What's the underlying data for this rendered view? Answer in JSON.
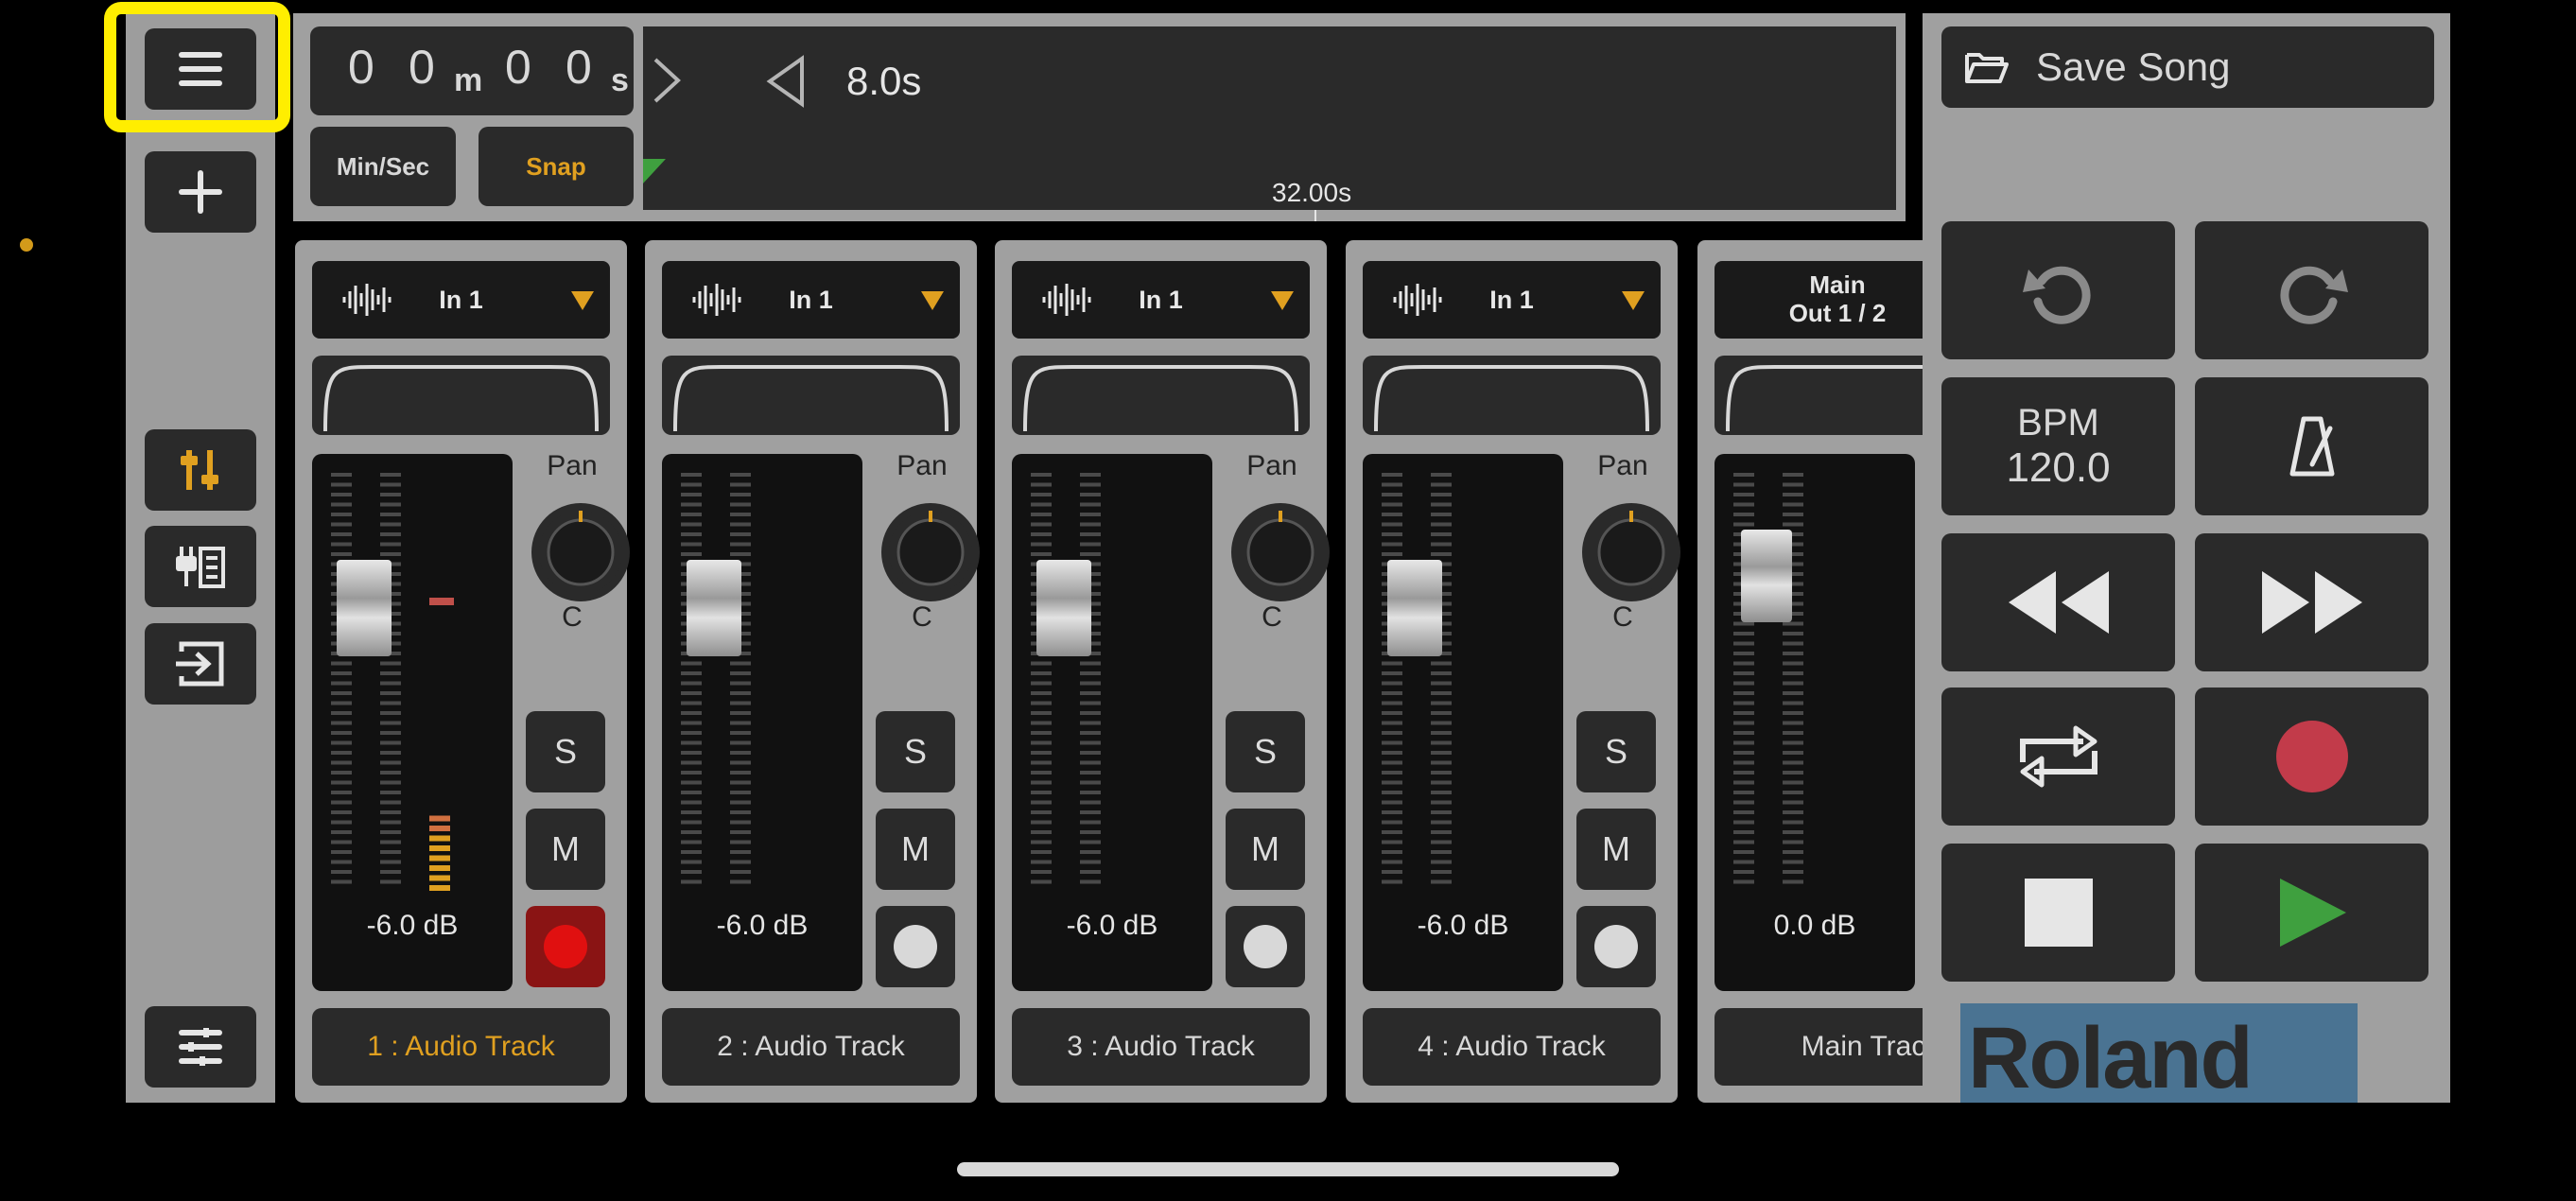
{
  "sidebar": {
    "buttons": [
      {
        "name": "menu-button",
        "icon": "hamburger-icon"
      },
      {
        "name": "add-track-button",
        "icon": "plus-icon"
      },
      {
        "name": "mixer-button",
        "icon": "mixer-sliders-icon"
      },
      {
        "name": "effects-button",
        "icon": "effects-plug-icon"
      },
      {
        "name": "input-button",
        "icon": "input-arrow-icon"
      },
      {
        "name": "track-list-button",
        "icon": "track-list-icon"
      }
    ]
  },
  "timer": {
    "minutes_digits": [
      "0",
      "0"
    ],
    "minutes_unit": "m",
    "seconds_digits": [
      "0",
      "0"
    ],
    "seconds_unit": "s"
  },
  "toolbar": {
    "min_sec_label": "Min/Sec",
    "snap_label": "Snap"
  },
  "timeline": {
    "zoom": "8.0s",
    "marker_time": "32.00s"
  },
  "tracks": [
    {
      "input": "In 1",
      "pan_label": "Pan",
      "pan_value": "C",
      "db": "-6.0 dB",
      "solo": "S",
      "mute": "M",
      "rec_armed": true,
      "name": "1 : Audio Track",
      "selected": true,
      "meter_level": 0.38
    },
    {
      "input": "In 1",
      "pan_label": "Pan",
      "pan_value": "C",
      "db": "-6.0 dB",
      "solo": "S",
      "mute": "M",
      "rec_armed": false,
      "name": "2 : Audio Track",
      "selected": false,
      "meter_level": 0
    },
    {
      "input": "In 1",
      "pan_label": "Pan",
      "pan_value": "C",
      "db": "-6.0 dB",
      "solo": "S",
      "mute": "M",
      "rec_armed": false,
      "name": "3 : Audio Track",
      "selected": false,
      "meter_level": 0
    },
    {
      "input": "In 1",
      "pan_label": "Pan",
      "pan_value": "C",
      "db": "-6.0 dB",
      "solo": "S",
      "mute": "M",
      "rec_armed": false,
      "name": "4 : Audio Track",
      "selected": false,
      "meter_level": 0
    }
  ],
  "main": {
    "output_line1": "Main",
    "output_line2": "Out 1 / 2",
    "db": "0.0 dB",
    "name": "Main Trac"
  },
  "right": {
    "save_label": "Save Song",
    "bpm_label": "BPM",
    "bpm_value": "120.0",
    "logo": "Roland"
  },
  "colors": {
    "accent": "#e0a020",
    "record": "#c23b4a",
    "play": "#3fa03f",
    "highlight": "#ffee00"
  }
}
